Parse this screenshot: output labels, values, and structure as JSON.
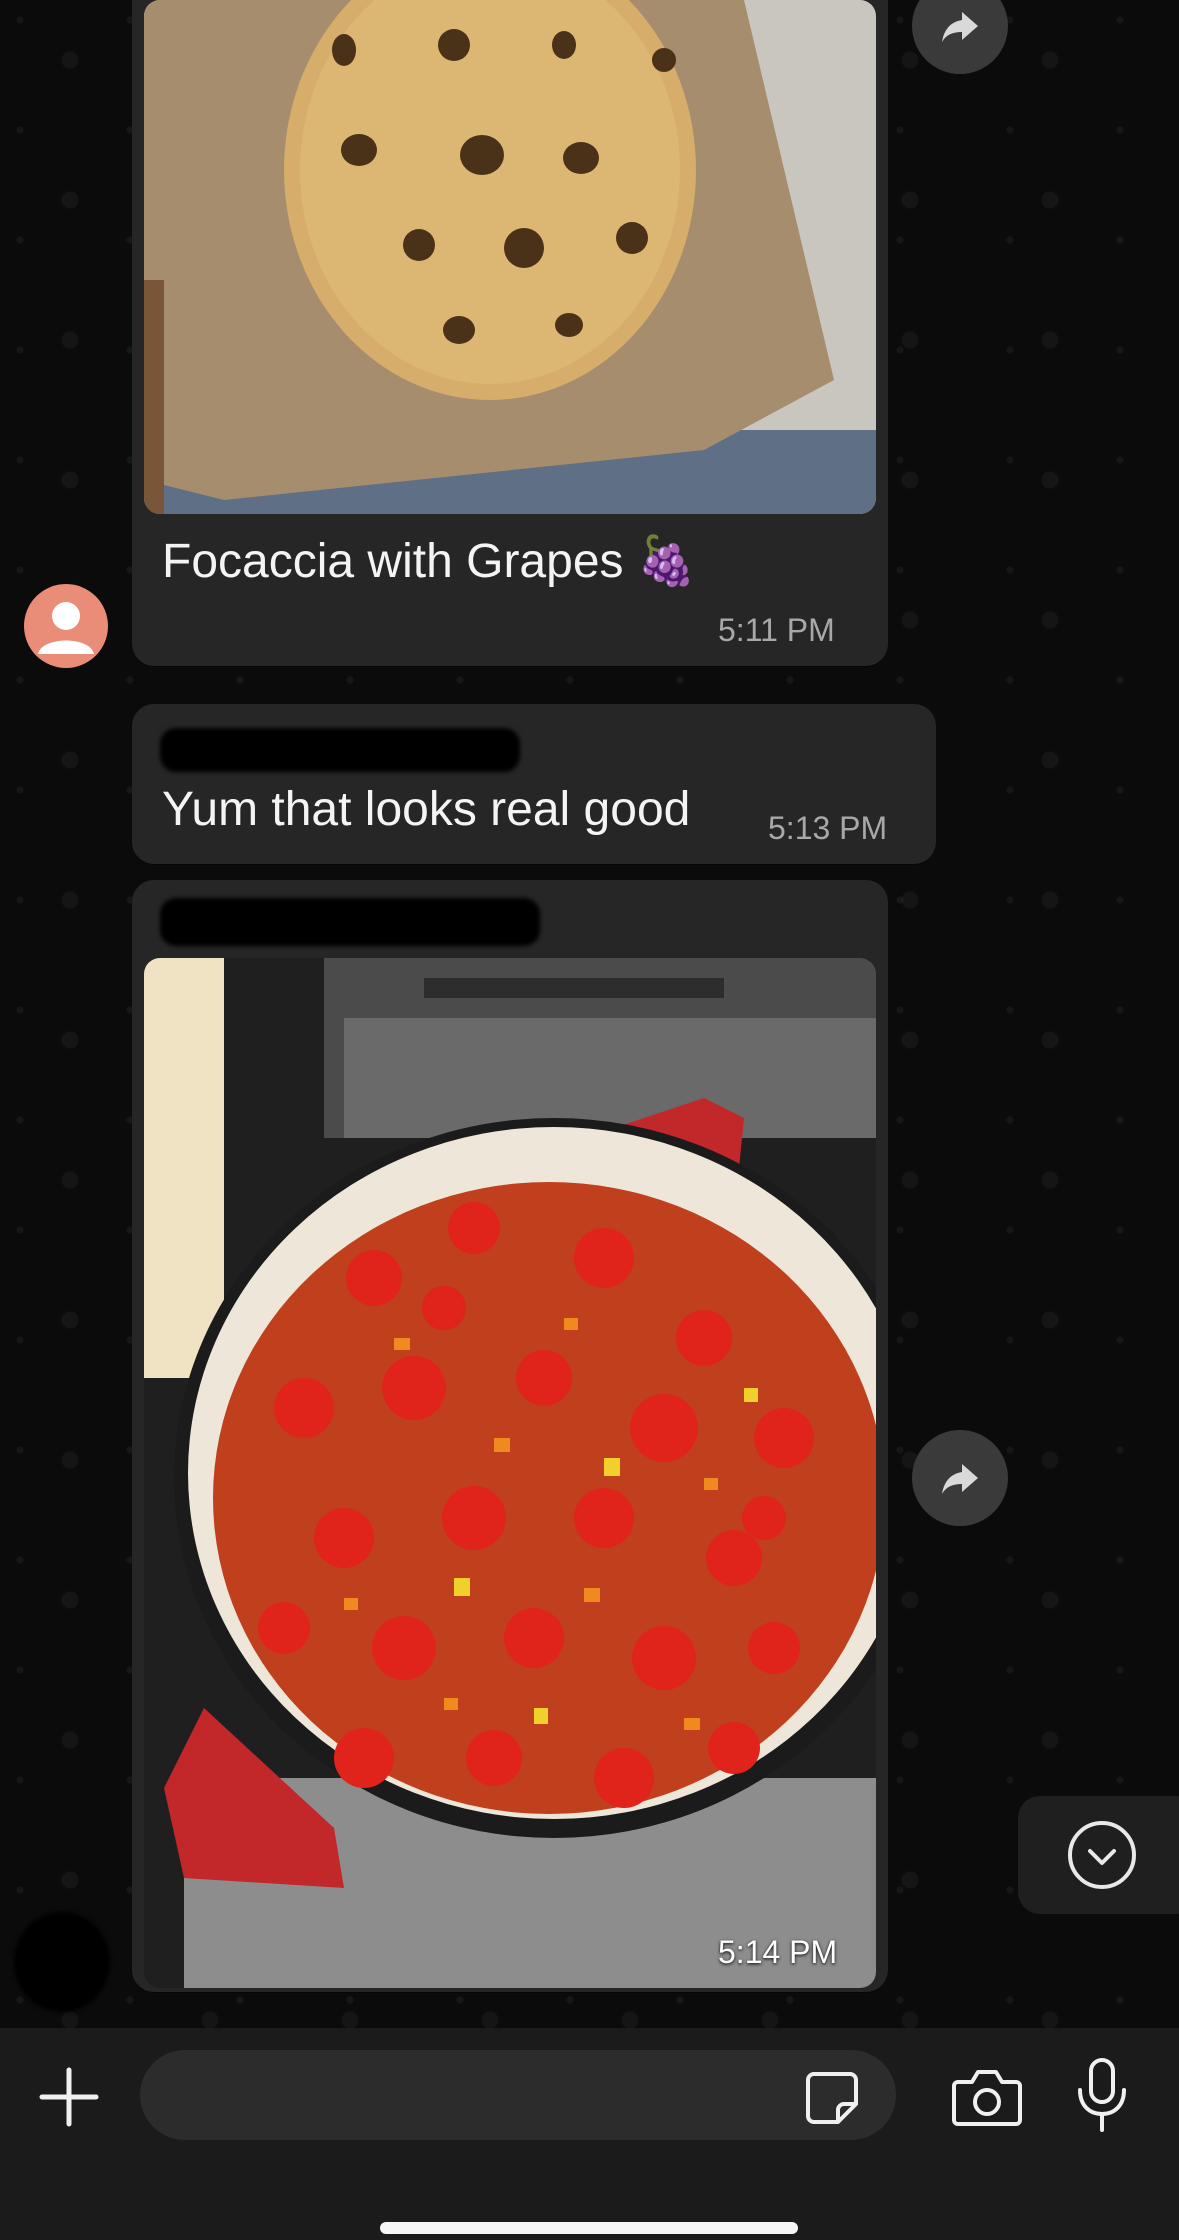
{
  "messages": [
    {
      "caption": "Focaccia with Grapes",
      "emoji": "🍇",
      "time": "5:11 PM"
    },
    {
      "text": "Yum that looks real good",
      "time": "5:13 PM"
    },
    {
      "time": "5:14 PM"
    }
  ],
  "icons": {
    "forward": "forward-arrow-icon",
    "avatar": "person-icon",
    "scroll_down": "chevron-down-icon",
    "attach": "plus-icon",
    "sticker": "sticker-icon",
    "camera": "camera-icon",
    "mic": "microphone-icon"
  },
  "colors": {
    "bubble": "#262626",
    "avatar": "#e98d78",
    "timestamp": "#a8a8a8"
  }
}
